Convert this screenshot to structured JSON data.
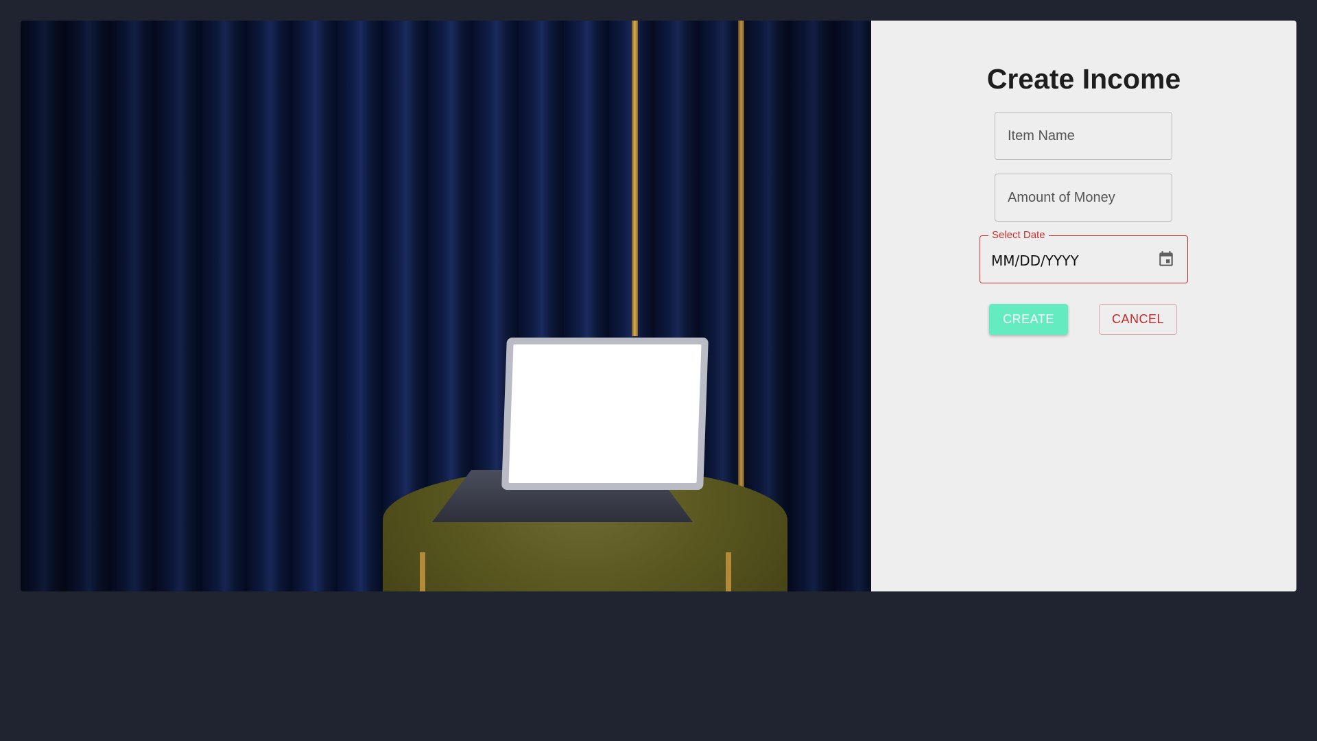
{
  "form": {
    "title": "Create Income",
    "item_name_placeholder": "Item Name",
    "amount_placeholder": "Amount of Money",
    "date_label": "Select Date",
    "date_placeholder": "MM/DD/YYYY",
    "create_label": "CREATE",
    "cancel_label": "CANCEL"
  },
  "icons": {
    "date": "calendar-icon"
  },
  "colors": {
    "page_background": "#1f2430",
    "panel_background": "#eeeeee",
    "create_button": "#64ecc0",
    "cancel_text": "#c62828",
    "date_error_border": "#d32f2f"
  }
}
